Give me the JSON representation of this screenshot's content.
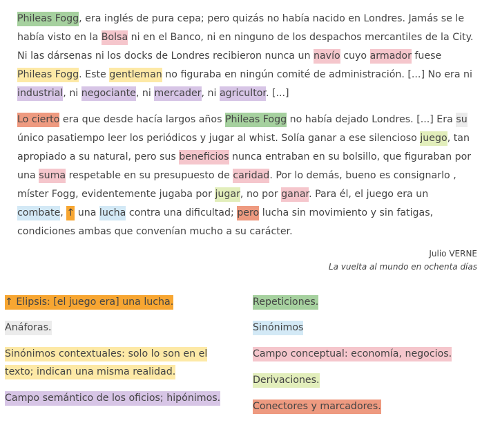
{
  "colors": {
    "repeticiones": "#a6d19f",
    "campo_conceptual": "#f5c6cc",
    "campo_semantico": "#d7c5e6",
    "sinonimos_contextuales": "#fde9a6",
    "conectores": "#ee9a80",
    "anaforas": "#ececec",
    "derivaciones": "#e2eebb",
    "sinonimos": "#d3e9f6",
    "elipsis": "#f7a632"
  },
  "p1": [
    {
      "t": "Phileas Fogg",
      "c": "rep"
    },
    {
      "t": ", era inglés de pura cepa; pero quizás no había nacido en Londres. Jamás se le había visto en la "
    },
    {
      "t": "Bolsa",
      "c": "camp"
    },
    {
      "t": " ni en el Banco, ni en ninguno de los despachos mercantiles de la City. Ni las dársenas ni los docks de Londres recibieron nunca un "
    },
    {
      "t": "navío",
      "c": "camp"
    },
    {
      "t": " cuyo "
    },
    {
      "t": "armador",
      "c": "camp"
    },
    {
      "t": " fuese "
    },
    {
      "t": "Phileas Fogg",
      "c": "ctx"
    },
    {
      "t": ". Este "
    },
    {
      "t": "gentleman",
      "c": "ctx"
    },
    {
      "t": " no figuraba en ningún comité de administración. [...] No era ni "
    },
    {
      "t": "industrial",
      "c": "ofi"
    },
    {
      "t": ", ni "
    },
    {
      "t": "negociante",
      "c": "ofi"
    },
    {
      "t": ", ni "
    },
    {
      "t": "mercader",
      "c": "ofi"
    },
    {
      "t": ", ni "
    },
    {
      "t": "agricultor",
      "c": "ofi"
    },
    {
      "t": ". [...]"
    }
  ],
  "p2": [
    {
      "t": "Lo cierto",
      "c": "con"
    },
    {
      "t": " era que desde hacía largos años "
    },
    {
      "t": "Phileas Fogg",
      "c": "rep"
    },
    {
      "t": " no había dejado Londres. [...] Era "
    },
    {
      "t": "su",
      "c": "ana"
    },
    {
      "t": " único pasatiempo leer los periódicos y jugar al whist. Solía ganar a ese silencioso "
    },
    {
      "t": "juego",
      "c": "der"
    },
    {
      "t": ", tan apropiado a su natural, pero sus "
    },
    {
      "t": "beneficios",
      "c": "camp"
    },
    {
      "t": " nunca entraban en su bolsillo, que figuraban por una "
    },
    {
      "t": "suma",
      "c": "camp"
    },
    {
      "t": " respetable en su presupuesto de "
    },
    {
      "t": "caridad",
      "c": "camp"
    },
    {
      "t": ". Por lo demás, bueno es consignarlo , míster Fogg, evidentemente jugaba por "
    },
    {
      "t": "jugar",
      "c": "der"
    },
    {
      "t": ", no por "
    },
    {
      "t": "ganar",
      "c": "camp"
    },
    {
      "t": ". Para él, el juego era un "
    },
    {
      "t": "combate",
      "c": "sin"
    },
    {
      "t": ", "
    },
    {
      "t": "↑",
      "c": "eli"
    },
    {
      "t": " una "
    },
    {
      "t": "lucha",
      "c": "sin"
    },
    {
      "t": " contra una dificultad; "
    },
    {
      "t": "pero",
      "c": "con"
    },
    {
      "t": " lucha sin movimiento y sin fatigas, condiciones ambas que convenían mucho a su carácter."
    }
  ],
  "author": {
    "name": "Julio VERNE",
    "work": "La vuelta al mundo en ochenta días"
  },
  "legend_left": [
    {
      "label": "↑ Elipsis: [el juego era] una lucha.",
      "c": "eli"
    },
    {
      "label": "Anáforas.",
      "c": "ana"
    },
    {
      "label": "Sinónimos contextuales: solo lo son en el texto; indican una misma realidad.",
      "c": "ctx"
    },
    {
      "label": "Campo semántico de los oficios; hipónimos.",
      "c": "ofi"
    }
  ],
  "legend_right": [
    {
      "label": "Repeticiones.",
      "c": "rep"
    },
    {
      "label": "Sinónimos",
      "c": "sin"
    },
    {
      "label": "Campo conceptual: economía, negocios.",
      "c": "camp"
    },
    {
      "label": "Derivaciones.",
      "c": "der"
    },
    {
      "label": "Conectores y marcadores.",
      "c": "con"
    }
  ]
}
